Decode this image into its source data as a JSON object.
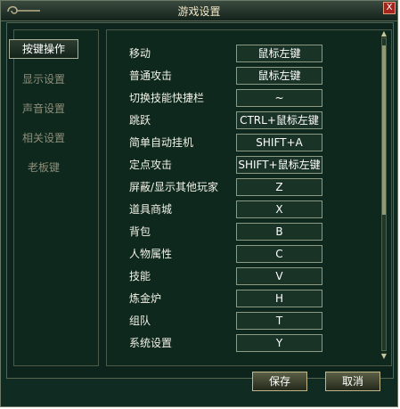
{
  "window": {
    "title": "游戏设置",
    "close_label": "X"
  },
  "sidebar": {
    "items": [
      {
        "label": "按键操作",
        "active": true
      },
      {
        "label": "显示设置",
        "active": false
      },
      {
        "label": "声音设置",
        "active": false
      },
      {
        "label": "相关设置",
        "active": false
      },
      {
        "label": "老板键",
        "active": false
      }
    ]
  },
  "keybinds": [
    {
      "action": "移动",
      "key": "鼠标左键"
    },
    {
      "action": "普通攻击",
      "key": "鼠标左键"
    },
    {
      "action": "切换技能快捷栏",
      "key": "~"
    },
    {
      "action": "跳跃",
      "key": "CTRL+鼠标左键"
    },
    {
      "action": "简单自动挂机",
      "key": "SHIFT+A"
    },
    {
      "action": "定点攻击",
      "key": "SHIFT+鼠标左键"
    },
    {
      "action": "屏蔽/显示其他玩家",
      "key": "Z"
    },
    {
      "action": "道具商城",
      "key": "X"
    },
    {
      "action": "背包",
      "key": "B"
    },
    {
      "action": "人物属性",
      "key": "C"
    },
    {
      "action": "技能",
      "key": "V"
    },
    {
      "action": "炼金炉",
      "key": "H"
    },
    {
      "action": "组队",
      "key": "T"
    },
    {
      "action": "系统设置",
      "key": "Y"
    }
  ],
  "buttons": {
    "save": "保存",
    "cancel": "取消"
  },
  "colors": {
    "background": "#0f2b22",
    "accent": "#c0b88a",
    "close": "#a6241e"
  }
}
